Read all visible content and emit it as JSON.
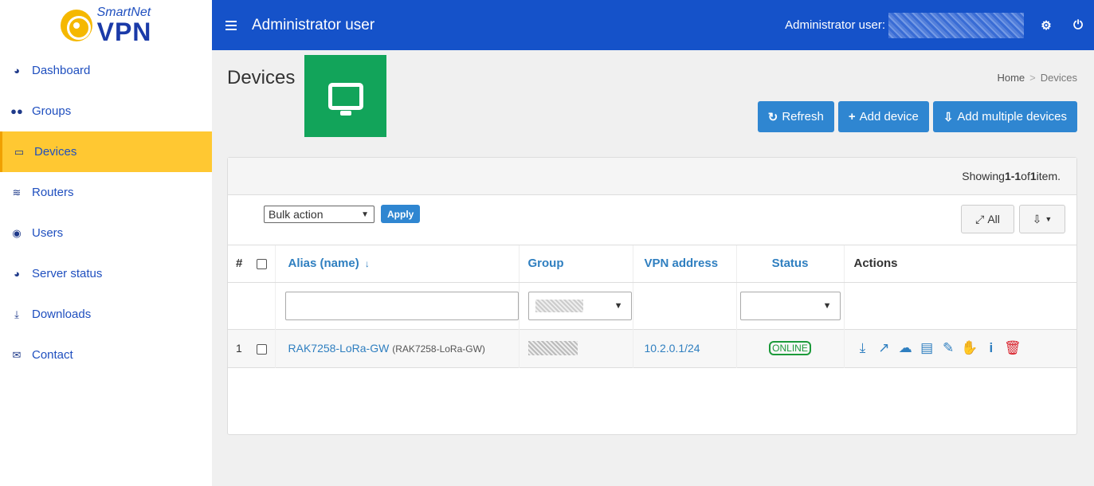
{
  "logo": {
    "small": "SmartNet",
    "big": "VPN"
  },
  "sidebar": {
    "items": [
      {
        "label": "Dashboard",
        "icon": "dashboard-icon"
      },
      {
        "label": "Groups",
        "icon": "users-icon"
      },
      {
        "label": "Devices",
        "icon": "monitor-icon"
      },
      {
        "label": "Routers",
        "icon": "wifi-icon"
      },
      {
        "label": "Users",
        "icon": "user-circle-icon"
      },
      {
        "label": "Server status",
        "icon": "dashboard-icon"
      },
      {
        "label": "Downloads",
        "icon": "download-icon"
      },
      {
        "label": "Contact",
        "icon": "envelope-icon"
      }
    ],
    "active": "Devices"
  },
  "header": {
    "title": "Administrator user",
    "user_label": "Administrator user:"
  },
  "page": {
    "title": "Devices",
    "breadcrumb": {
      "home": "Home",
      "separator": ">",
      "current": "Devices"
    },
    "buttons": {
      "refresh": "Refresh",
      "add_device": "Add device",
      "add_multiple": "Add multiple devices"
    }
  },
  "grid": {
    "summary_prefix": "Showing ",
    "summary_range": "1-1",
    "summary_of": " of ",
    "summary_total": "1",
    "summary_suffix": " item.",
    "bulk_action": "Bulk action",
    "apply": "Apply",
    "all_label": "All",
    "columns": {
      "num": "#",
      "alias": "Alias (name)",
      "group": "Group",
      "vpn": "VPN address",
      "status": "Status",
      "actions": "Actions"
    },
    "rows": [
      {
        "num": "1",
        "alias": "RAK7258-LoRa-GW",
        "name": "(RAK7258-LoRa-GW)",
        "vpn": "10.2.0.1/24",
        "status": "ONLINE"
      }
    ]
  },
  "colors": {
    "topbar": "#1552c9",
    "active_nav": "#ffc832",
    "button": "#2f86d1",
    "online": "#1c9a3a",
    "tile": "#12a45a"
  }
}
